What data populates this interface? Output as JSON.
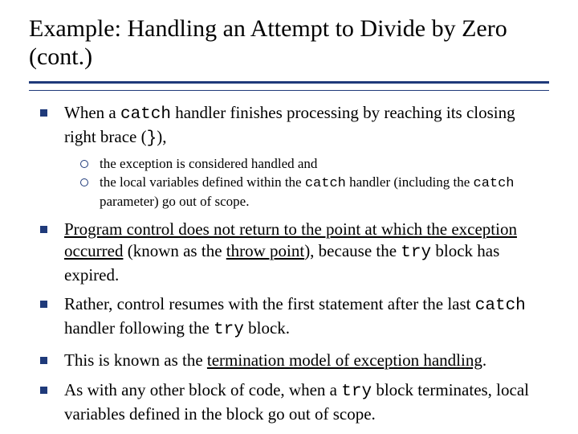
{
  "title": "Example: Handling an Attempt to Divide by Zero (cont.)",
  "b1": {
    "p1": "When a ",
    "code1": "catch",
    "p2": " handler finishes processing by reaching its closing right brace (",
    "code2": "}",
    "p3": "),",
    "sub1": "the exception is considered handled and",
    "sub2": {
      "a": "the local variables defined within the ",
      "c1": "catch",
      "b": " handler (including the ",
      "c2": "catch",
      "c": " parameter) go out of scope."
    }
  },
  "b2": {
    "a": "Program control does not return to the point at which the exception occurred",
    "b": " (known as the ",
    "c": "throw point",
    "d": "), because the ",
    "code": "try",
    "e": " block has expired."
  },
  "b3": {
    "a": "Rather, control resumes with the first statement after the last ",
    "c1": "catch",
    "b": " handler following the ",
    "c2": "try",
    "c": " block."
  },
  "b4": {
    "a": "This is known as the ",
    "u": "termination model of exception handling",
    "b": "."
  },
  "b5": {
    "a": "As with any other block of code, when a ",
    "code": "try",
    "b": " block terminates, local variables defined in the block go out of scope."
  }
}
